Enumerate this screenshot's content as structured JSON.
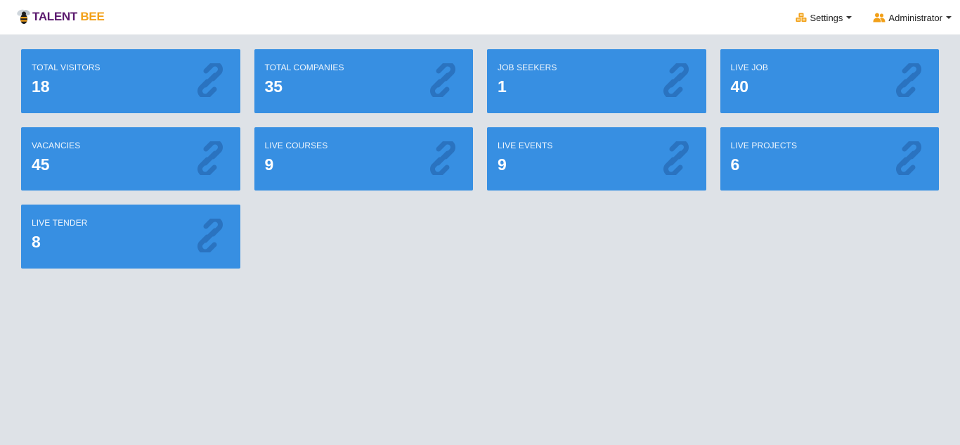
{
  "brand": {
    "word1": "TALENT",
    "word2": "BEE"
  },
  "nav": {
    "settings_label": "Settings",
    "user_label": "Administrator"
  },
  "colors": {
    "card_bg": "#378fe2",
    "card_icon": "#2a73c0",
    "nav_icon": "#f2a018",
    "page_bg": "#dee2e7"
  },
  "stats": [
    {
      "label": "TOTAL VISITORS",
      "value": "18"
    },
    {
      "label": "TOTAL COMPANIES",
      "value": "35"
    },
    {
      "label": "JOB SEEKERS",
      "value": "1"
    },
    {
      "label": "LIVE JOB",
      "value": "40"
    },
    {
      "label": "VACANCIES",
      "value": "45"
    },
    {
      "label": "LIVE COURSES",
      "value": "9"
    },
    {
      "label": "LIVE EVENTS",
      "value": "9"
    },
    {
      "label": "LIVE PROJECTS",
      "value": "6"
    },
    {
      "label": "LIVE TENDER",
      "value": "8"
    }
  ],
  "stat_icon": "link-icon"
}
